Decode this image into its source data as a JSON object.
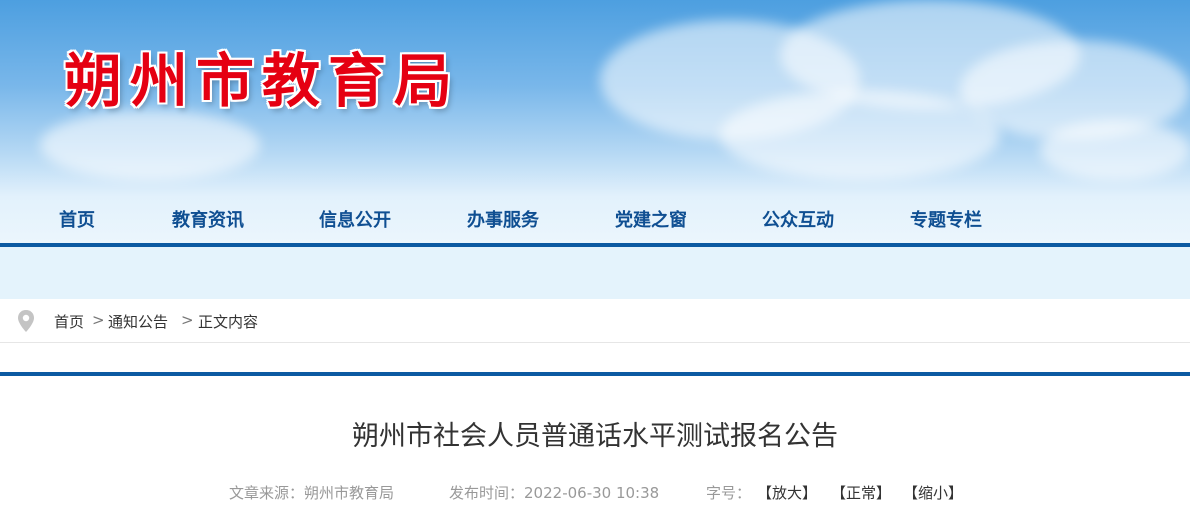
{
  "header": {
    "site_title": "朔州市教育局"
  },
  "nav": {
    "items": [
      "首页",
      "教育资讯",
      "信息公开",
      "办事服务",
      "党建之窗",
      "公众互动",
      "专题专栏"
    ]
  },
  "breadcrumb": {
    "icon": "location-pin-icon",
    "items": [
      "首页",
      "通知公告",
      "正文内容"
    ],
    "separator": ">"
  },
  "article": {
    "title": "朔州市社会人员普通话水平测试报名公告",
    "source_label": "文章来源：",
    "source_value": "朔州市教育局",
    "date_label": "发布时间：",
    "date_value": "2022-06-30 10:38",
    "fontsize_label": "字号：",
    "font_larger": "【放大】",
    "font_normal": "【正常】",
    "font_smaller": "【缩小】"
  },
  "colors": {
    "title_red": "#e50012",
    "nav_blue": "#0f4f92",
    "rule_blue": "#0c5aa2",
    "band": "#e4f3fc"
  }
}
